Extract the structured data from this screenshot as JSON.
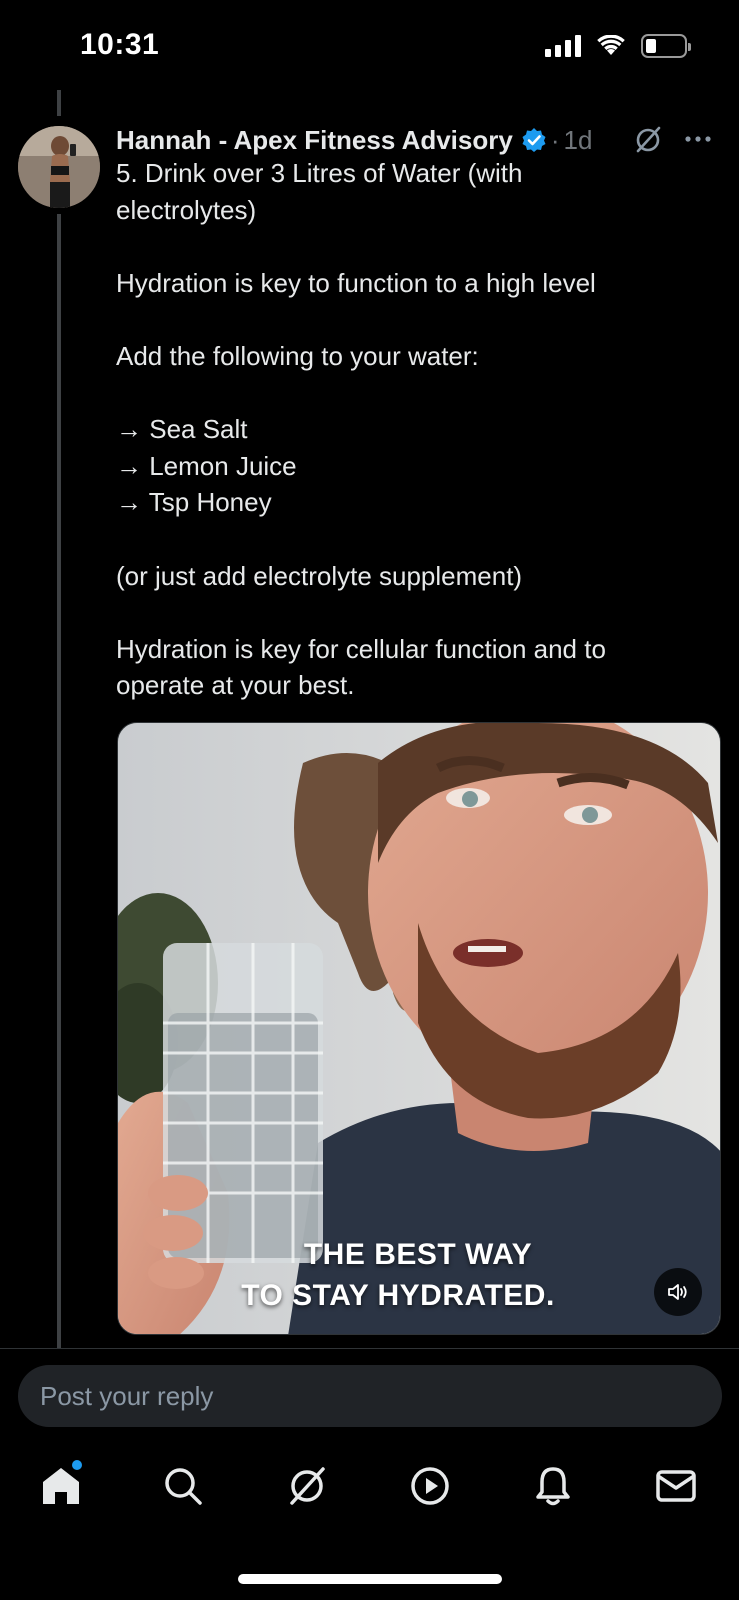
{
  "status_bar": {
    "time": "10:31"
  },
  "post": {
    "author": "Hannah - Apex Fitness Advisory",
    "separator": "·",
    "timestamp": "1d",
    "lines": [
      "5. Drink over 3 Litres of Water (with",
      "electrolytes)",
      "",
      "Hydration is key to function to a high level",
      "",
      "Add the following to your water:",
      "",
      "→ Sea Salt",
      "→ Lemon Juice",
      "→ Tsp Honey",
      "",
      "(or just add electrolyte supplement)",
      "",
      "Hydration is key for cellular function and to",
      "operate at your best."
    ],
    "media": {
      "caption_line1": "THE BEST WAY",
      "caption_line2": "TO STAY HYDRATED."
    }
  },
  "reply": {
    "placeholder": "Post your reply"
  },
  "nav": {
    "items": [
      "home-icon",
      "search-icon",
      "grok-icon",
      "video-icon",
      "notifications-icon",
      "messages-icon"
    ]
  },
  "colors": {
    "background": "#000000",
    "text": "#e7e9ea",
    "muted": "#71767b",
    "accent": "#1d9bf0",
    "reply_bg": "#202327"
  }
}
